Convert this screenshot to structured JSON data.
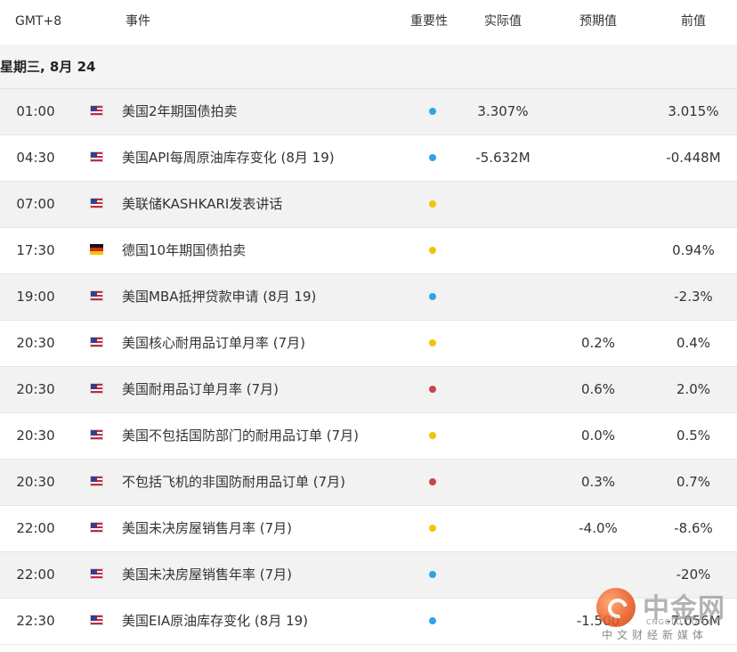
{
  "header": {
    "timezone": "GMT+8",
    "event": "事件",
    "importance": "重要性",
    "actual": "实际值",
    "forecast": "预期值",
    "previous": "前值"
  },
  "date_label": "星期三, 8月 24",
  "colors": {
    "importance_low": "#2fa3e6",
    "importance_medium": "#f2c500",
    "importance_high": "#c8434a"
  },
  "rows": [
    {
      "time": "01:00",
      "flag": "us-flag-icon",
      "event": "美国2年期国债拍卖",
      "importance": "low",
      "actual": "3.307%",
      "forecast": "",
      "previous": "3.015%"
    },
    {
      "time": "04:30",
      "flag": "us-flag-icon",
      "event": "美国API每周原油库存变化 (8月 19)",
      "importance": "low",
      "actual": "-5.632M",
      "forecast": "",
      "previous": "-0.448M"
    },
    {
      "time": "07:00",
      "flag": "us-flag-icon",
      "event": "美联储KASHKARI发表讲话",
      "importance": "medium",
      "actual": "",
      "forecast": "",
      "previous": ""
    },
    {
      "time": "17:30",
      "flag": "de-flag-icon",
      "event": "德国10年期国债拍卖",
      "importance": "medium",
      "actual": "",
      "forecast": "",
      "previous": "0.94%"
    },
    {
      "time": "19:00",
      "flag": "us-flag-icon",
      "event": "美国MBA抵押贷款申请 (8月 19)",
      "importance": "low",
      "actual": "",
      "forecast": "",
      "previous": "-2.3%"
    },
    {
      "time": "20:30",
      "flag": "us-flag-icon",
      "event": "美国核心耐用品订单月率 (7月)",
      "importance": "medium",
      "actual": "",
      "forecast": "0.2%",
      "previous": "0.4%"
    },
    {
      "time": "20:30",
      "flag": "us-flag-icon",
      "event": "美国耐用品订单月率 (7月)",
      "importance": "high",
      "actual": "",
      "forecast": "0.6%",
      "previous": "2.0%"
    },
    {
      "time": "20:30",
      "flag": "us-flag-icon",
      "event": "美国不包括国防部门的耐用品订单 (7月)",
      "importance": "medium",
      "actual": "",
      "forecast": "0.0%",
      "previous": "0.5%"
    },
    {
      "time": "20:30",
      "flag": "us-flag-icon",
      "event": "不包括飞机的非国防耐用品订单 (7月)",
      "importance": "high",
      "actual": "",
      "forecast": "0.3%",
      "previous": "0.7%"
    },
    {
      "time": "22:00",
      "flag": "us-flag-icon",
      "event": "美国未决房屋销售月率 (7月)",
      "importance": "medium",
      "actual": "",
      "forecast": "-4.0%",
      "previous": "-8.6%"
    },
    {
      "time": "22:00",
      "flag": "us-flag-icon",
      "event": "美国未决房屋销售年率 (7月)",
      "importance": "low",
      "actual": "",
      "forecast": "",
      "previous": "-20%"
    },
    {
      "time": "22:30",
      "flag": "us-flag-icon",
      "event": "美国EIA原油库存变化 (8月 19)",
      "importance": "low",
      "actual": "",
      "forecast": "-1.500",
      "previous": "-7.056M"
    }
  ],
  "watermark": {
    "name": "中金网",
    "subtitle": "中文财经新媒体",
    "url": "CNGOLD.COM.CN"
  }
}
